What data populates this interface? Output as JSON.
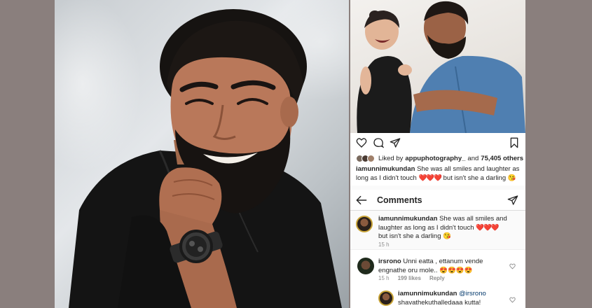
{
  "post": {
    "liked_by_prefix": "Liked by",
    "liked_by_user": "appuphotography_",
    "liked_by_and": "and",
    "liked_by_others": "75,405 others",
    "caption_user": "iamunnimukundan",
    "caption_text": "She was all smiles and laughter as long as I didn't touch",
    "caption_hearts": "❤️❤️❤️",
    "caption_tail": "but isn't she a darling",
    "caption_emoji": "😘"
  },
  "comments_header": {
    "title": "Comments"
  },
  "comments": [
    {
      "user": "iamunnimukundan",
      "text": "She was all smiles and laughter as long as I didn't touch",
      "hearts": "❤️❤️❤️",
      "tail": "but isn't she a darling",
      "emoji": "😘",
      "time": "15 h"
    },
    {
      "user": "irsrono",
      "text": "Unni eatta , ettanum vende engnathe oru mole..",
      "emoji": "😍😍😍😍",
      "time": "15 h",
      "likes": "199 likes",
      "reply": "Reply"
    },
    {
      "user": "iamunnimukundan",
      "mention": "@irsrono",
      "text": "shavathekuthalledaaa kutta!"
    }
  ],
  "icons": {
    "like": "heart-icon",
    "comment": "comment-icon",
    "share": "send-icon",
    "save": "bookmark-icon",
    "back": "back-arrow-icon",
    "direct": "send-icon"
  },
  "colors": {
    "background": "#8a7f7d",
    "instagram_text": "#262626",
    "instagram_muted": "#8e8e8e",
    "heart_red": "#ed4956"
  }
}
